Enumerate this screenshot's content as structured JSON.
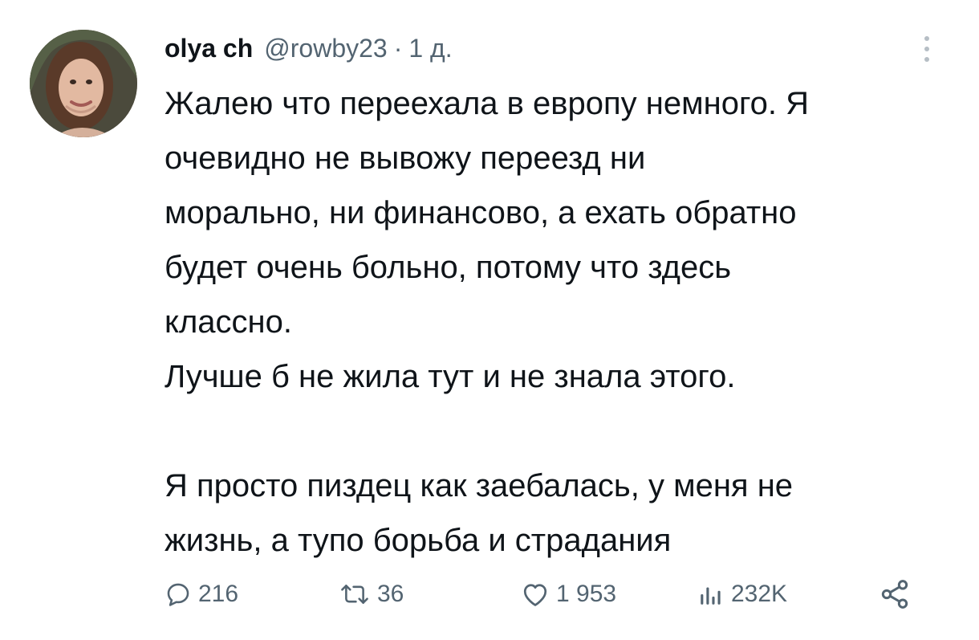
{
  "author": {
    "display_name": "olya ch",
    "handle": "@rowby23",
    "separator": "·",
    "time_ago": "1 д."
  },
  "tweet": {
    "paragraph_1": "Жалею что переехала в европу немного. Я\nочевидно не вывожу переезд ни\nморально, ни финансово, а ехать обратно\nбудет очень больно, потому что здесь\nклассно.\nЛучше б не жила тут и не знала этого.",
    "paragraph_2": "Я просто пиздец как заебалась, у меня не\nжизнь, а тупо борьба и страдания"
  },
  "actions": {
    "replies": "216",
    "retweets": "36",
    "likes": "1 953",
    "views": "232K"
  },
  "icons": {
    "reply": "reply-icon",
    "retweet": "retweet-icon",
    "like": "heart-icon",
    "views": "views-icon",
    "share": "share-icon",
    "more": "more-icon"
  },
  "colors": {
    "text": "#0f1419",
    "secondary": "#536471",
    "background": "#ffffff"
  }
}
